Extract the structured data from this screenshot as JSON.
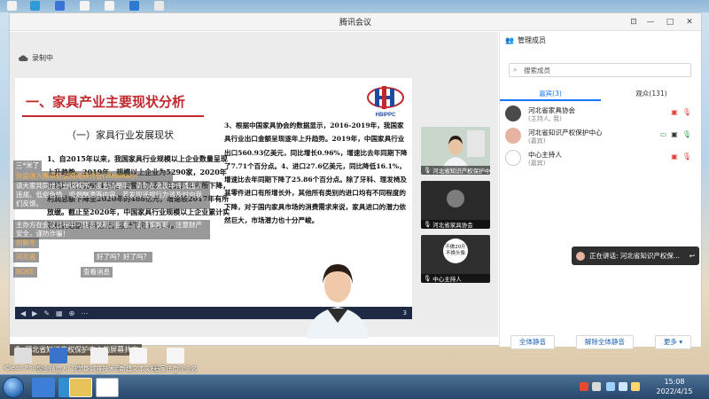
{
  "window": {
    "title": "腾讯会议"
  },
  "recording": {
    "label": "录制中"
  },
  "slide": {
    "heading": "一、家具产业主要现状分析",
    "logo_text": "HBIPPC",
    "subheading": "（一）家具行业发展现状",
    "left_paragraph": "1、自2015年以来，我国家具行业规模以上企业数量呈现上升趋势。2019年，规模以上企业为5290家，2020年规模以上企业6544家。主营业务收入在近两年有所下降，利润总额下降至2020年的488亿元，增速较2017年有所放缓。截止至2020年，中国家具行业规模以上企业累计实现利润总额488亿元，累计下降11.1%。",
    "right_paragraph": "3、根据中国家具协会的数据显示，2016-2019年，我国家具行业出口金额呈现逐年上升趋势。2019年，中国家具行业出口560.93亿美元，同比增长0.96%，增速比去年同期下降了7.71个百分点。4、进口27.6亿美元，同比降低16.1%，增速比去年同期下降了25.86个百分点。除了牙科、理发椅及其零件进口有所增长外，其他所有类别的进口均有不同程度的下降，对于国内家具市场的消费需求来说，家具进口的潜力依然巨大，市场潜力也十分严峻。",
    "page_number": "3"
  },
  "chat_overlay": [
    {
      "sender": "三*米了",
      "text": ""
    },
    {
      "sender": "",
      "text": "欢迎进入腾讯会议网络研讨会(Webinar)！"
    },
    {
      "sender": "",
      "text": "请大家共同维护会议秩序，发言请举手。请勿在会议中传播违法违规、低俗色情、吸烟酗酒等内容，若发现违规行为请及时向我们反馈。"
    },
    {
      "sender": "",
      "text": "主办方在会议过程中可能会录制、回看、请谨慎判断，注意财产安全，谨防诈骗！"
    },
    {
      "sender": "刘新冬",
      "text": ""
    },
    {
      "sender": "河北省",
      "text": "好了吗？好了吗？"
    },
    {
      "sender": "BOKE",
      "text": "查看消息"
    }
  ],
  "thumbnails": [
    {
      "name": "河北省知识产权保护中心"
    },
    {
      "name": "河北省家具协会"
    },
    {
      "name": "中心主持人",
      "avatar_text": "不做20斤 不换头像"
    }
  ],
  "screen_share_caption": "河北省知识产权保护中心的屏幕共享",
  "speaking_popup": {
    "text": "正在讲话: 河北省知识产权保..."
  },
  "members_panel": {
    "title": "管理成员",
    "search_placeholder": "搜索成员",
    "tabs": [
      {
        "label": "嘉宾(3)"
      },
      {
        "label": "观众(131)"
      }
    ],
    "members": [
      {
        "name": "河北省家具协会",
        "role": "(主持人, 我)"
      },
      {
        "name": "河北省知识产权保护中心",
        "role": "(嘉宾)"
      },
      {
        "name": "中心主持人",
        "role": "(嘉宾)"
      }
    ],
    "footer": {
      "mute_all": "全体静音",
      "unmute_all": "解除全体静音",
      "more": "更多"
    }
  },
  "desktop_icons": [
    {
      "label": "iClean Photo"
    },
    {
      "label": "企业微信入门指南"
    },
    {
      "label": "节能减排技术目录"
    },
    {
      "label": "新建文本文档"
    },
    {
      "label": "石家庄市企业名录"
    }
  ],
  "taskbar": {
    "time": "15:08",
    "date": "2022/4/15"
  },
  "colors": {
    "accent": "#1677ff",
    "slide_heading": "#c0282d",
    "taskbar": "#27476b"
  }
}
